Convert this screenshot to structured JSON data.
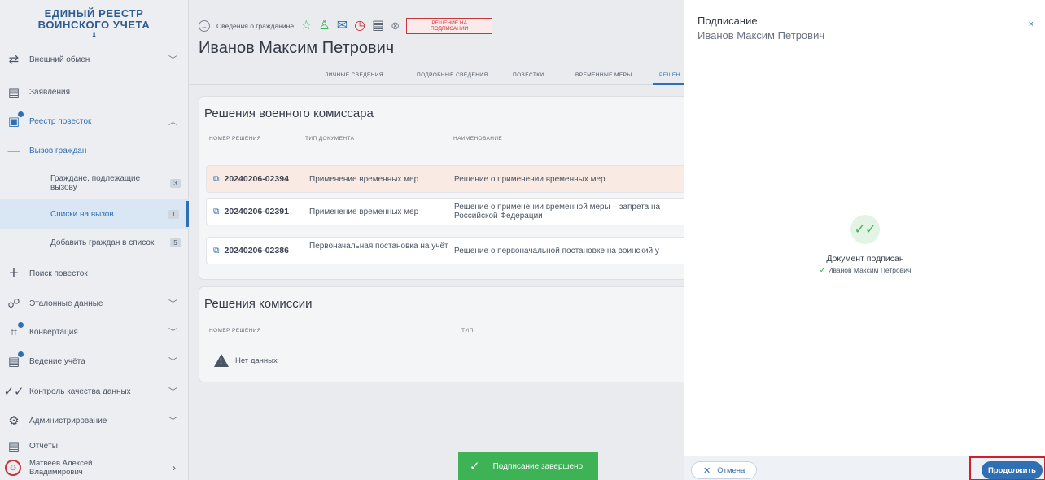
{
  "sidebar": {
    "brand_line1": "ЕДИНЫЙ РЕЕСТР",
    "brand_line2": "ВОИНСКОГО УЧЕТА",
    "items": [
      {
        "label": "Внешний обмен"
      },
      {
        "label": "Заявления"
      },
      {
        "label": "Реестр повесток"
      },
      {
        "label": "Вызов граждан"
      },
      {
        "label": "Граждане, подлежащие вызову",
        "count": "3"
      },
      {
        "label": "Списки на вызов",
        "count": "1"
      },
      {
        "label": "Добавить граждан в список",
        "count": "5"
      },
      {
        "label": "Поиск повесток"
      },
      {
        "label": "Эталонные данные"
      },
      {
        "label": "Конвертация"
      },
      {
        "label": "Ведение учёта"
      },
      {
        "label": "Контроль качества данных"
      },
      {
        "label": "Администрирование"
      },
      {
        "label": "Отчёты"
      }
    ],
    "user": {
      "name": "Матвеев Алексей Владимирович"
    }
  },
  "main": {
    "breadcrumb": "Сведения о гражданине",
    "status": "РЕШЕНИЕ НА ПОДПИСАНИИ",
    "title": "Иванов Максим Петрович",
    "tabs": [
      {
        "label": "ЛИЧНЫЕ СВЕДЕНИЯ"
      },
      {
        "label": "ПОДРОБНЫЕ СВЕДЕНИЯ"
      },
      {
        "label": "ПОВЕСТКИ"
      },
      {
        "label": "ВРЕМЕННЫЕ МЕРЫ"
      },
      {
        "label": "РЕШЕН"
      }
    ],
    "decisions": {
      "title": "Решения военного комиссара",
      "headers": {
        "number": "НОМЕР РЕШЕНИЯ",
        "doc_type": "ТИП ДОКУМЕНТА",
        "name": "НАИМЕНОВАНИЕ"
      },
      "rows": [
        {
          "number": "20240206-02394",
          "doc_type": "Применение временных мер",
          "name": "Решение о применении временных мер"
        },
        {
          "number": "20240206-02391",
          "doc_type": "Применение временных мер",
          "name": "Решение о применении временной меры – запрета на Российской Федерации"
        },
        {
          "number": "20240206-02386",
          "doc_type": "Первоначальная постановка на учёт",
          "name": "Решение о первоначальной постановке на воинский у"
        }
      ]
    },
    "commission": {
      "title": "Решения комиссии",
      "headers": {
        "number": "НОМЕР РЕШЕНИЯ",
        "type": "ТИП"
      },
      "empty": "Нет данных"
    },
    "toast": "Подписание завершено"
  },
  "drawer": {
    "title": "Подписание",
    "subtitle": "Иванов Максим Петрович",
    "close": "×",
    "status_text": "Документ подписан",
    "signer": "Иванов Максим Петрович",
    "cancel": "Отмена",
    "continue": "Продолжить"
  }
}
